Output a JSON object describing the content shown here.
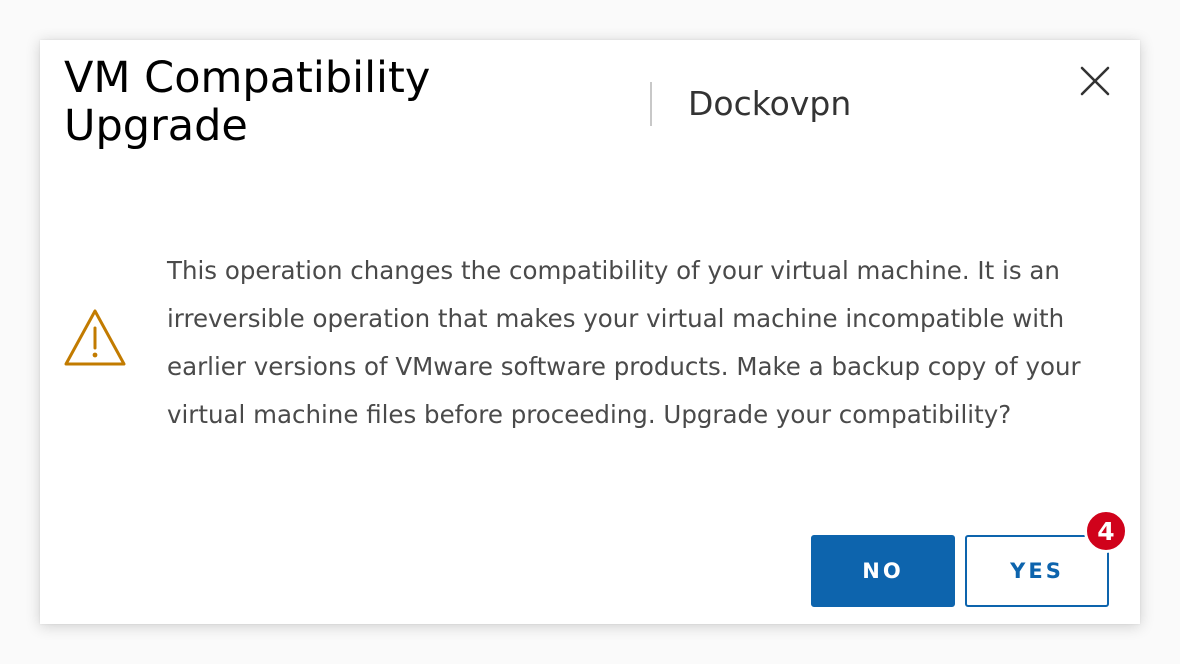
{
  "dialog": {
    "title": "VM Compatibility Upgrade",
    "subtitle": "Dockovpn",
    "close_icon": "close-icon",
    "warning_icon": "warning-triangle-icon",
    "message": "This operation changes the compatibility of your virtual machine. It is an irreversible operation that makes your virtual machine incompatible with earlier versions of VMware software products. Make a backup copy of your virtual machine files before proceeding. Upgrade your compatibility?",
    "buttons": {
      "no_label": "NO",
      "yes_label": "YES"
    },
    "badge": "4"
  },
  "colors": {
    "primary": "#0d64ad",
    "warning": "#c27b00",
    "badge": "#d0021b",
    "text": "#4a4a4a"
  }
}
